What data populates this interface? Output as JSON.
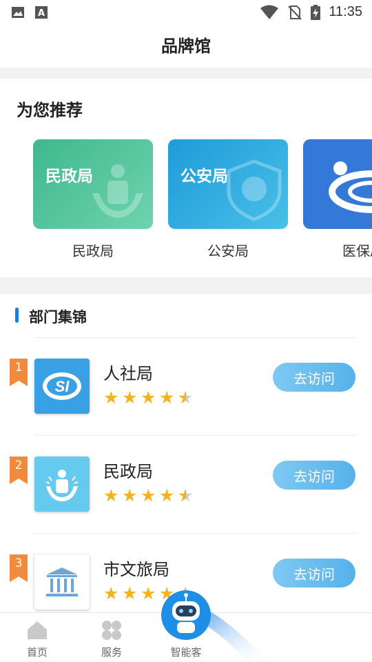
{
  "status_bar": {
    "time": "11:35"
  },
  "header": {
    "title": "品牌馆"
  },
  "recommend": {
    "heading": "为您推荐",
    "items": [
      {
        "tile_label": "民政局",
        "caption": "民政局",
        "color": "#4dbf95"
      },
      {
        "tile_label": "公安局",
        "caption": "公安局",
        "color": "#2ea6dc"
      },
      {
        "tile_label": "",
        "caption": "医保局",
        "color": "#3479d8"
      }
    ]
  },
  "departments": {
    "heading": "部门集锦",
    "items": [
      {
        "rank": "1",
        "name": "人社局",
        "rating": 4.5,
        "button": "去访问",
        "logo": "si-icon"
      },
      {
        "rank": "2",
        "name": "民政局",
        "rating": 4.5,
        "button": "去访问",
        "logo": "civil-affairs-icon"
      },
      {
        "rank": "3",
        "name": "市文旅局",
        "rating": 4.5,
        "button": "去访问",
        "logo": "museum-icon"
      }
    ]
  },
  "tabbar": {
    "items": [
      {
        "label": "首页",
        "icon": "home-icon"
      },
      {
        "label": "服务",
        "icon": "grid-icon"
      },
      {
        "label": "智能客",
        "icon": "robot-icon"
      }
    ]
  }
}
